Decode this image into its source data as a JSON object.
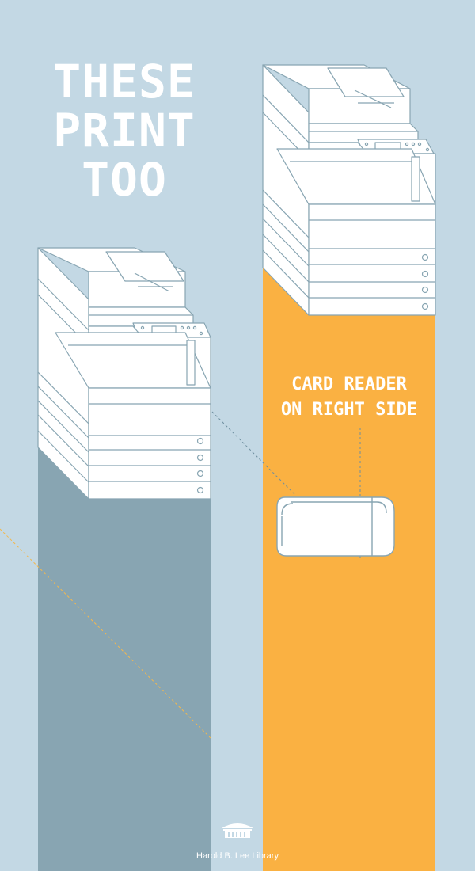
{
  "poster": {
    "headline": [
      "THESE",
      "PRINT",
      "TOO"
    ],
    "callout": [
      "CARD READER",
      "ON RIGHT SIDE"
    ],
    "footer_text": "Harold B. Lee Library"
  },
  "colors": {
    "background": "#c3d8e4",
    "left_column": "#88a5b2",
    "right_column": "#fab142",
    "line_art": "#88a5b2",
    "text": "#ffffff"
  },
  "icons": [
    "printer-icon",
    "card-reader-icon",
    "library-building-icon"
  ]
}
